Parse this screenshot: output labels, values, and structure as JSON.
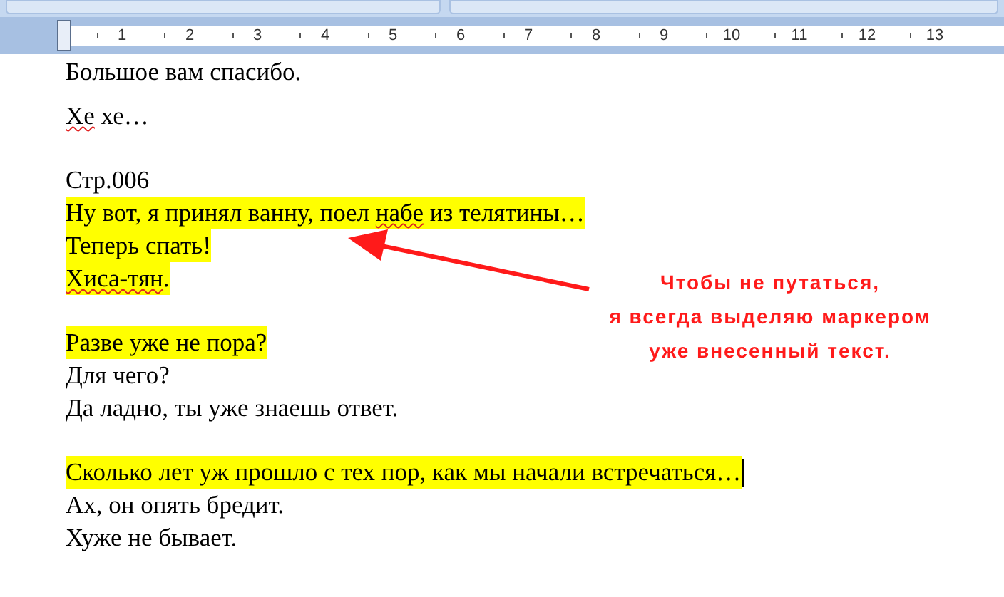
{
  "ruler": {
    "numbers": [
      "1",
      "2",
      "3",
      "4",
      "5",
      "6",
      "7",
      "8",
      "9",
      "10",
      "11",
      "12",
      "13"
    ]
  },
  "paragraphs": [
    {
      "lines": [
        {
          "highlighted": false,
          "cursor": false,
          "segments": [
            {
              "text": "Большое вам спасибо.",
              "misspelled": false
            }
          ]
        }
      ]
    },
    {
      "lines": [
        {
          "highlighted": false,
          "cursor": false,
          "segments": [
            {
              "text": "Хе",
              "misspelled": true
            },
            {
              "text": " хе…",
              "misspelled": false
            }
          ]
        }
      ]
    },
    {
      "lines": [
        {
          "highlighted": false,
          "cursor": false,
          "segments": [
            {
              "text": "Стр.006",
              "misspelled": false
            }
          ]
        },
        {
          "highlighted": true,
          "cursor": false,
          "segments": [
            {
              "text": "Ну вот, я принял ванну, поел ",
              "misspelled": false
            },
            {
              "text": "набе",
              "misspelled": true
            },
            {
              "text": " из телятины…",
              "misspelled": false
            }
          ]
        },
        {
          "highlighted": true,
          "cursor": false,
          "segments": [
            {
              "text": "Теперь спать!",
              "misspelled": false
            }
          ]
        },
        {
          "highlighted": true,
          "cursor": false,
          "segments": [
            {
              "text": "Хиса-тян",
              "misspelled": true
            },
            {
              "text": ".",
              "misspelled": false
            }
          ]
        }
      ]
    },
    {
      "lines": [
        {
          "highlighted": true,
          "cursor": false,
          "segments": [
            {
              "text": "Разве уже не пора?",
              "misspelled": false
            }
          ]
        },
        {
          "highlighted": false,
          "cursor": false,
          "segments": [
            {
              "text": "Для чего?",
              "misspelled": false
            }
          ]
        },
        {
          "highlighted": false,
          "cursor": false,
          "segments": [
            {
              "text": "Да ладно, ты уже знаешь ответ.",
              "misspelled": false
            }
          ]
        }
      ]
    },
    {
      "lines": [
        {
          "highlighted": true,
          "cursor": true,
          "segments": [
            {
              "text": "Сколько лет уж прошло с тех пор, как мы начали встречаться…",
              "misspelled": false
            }
          ]
        },
        {
          "highlighted": false,
          "cursor": false,
          "segments": [
            {
              "text": "Ах, он опять бредит.",
              "misspelled": false
            }
          ]
        },
        {
          "highlighted": false,
          "cursor": false,
          "segments": [
            {
              "text": "Хуже не бывает.",
              "misspelled": false
            }
          ]
        }
      ]
    }
  ],
  "annotation": {
    "lines": [
      "Чтобы не путаться,",
      "я всегда выделяю маркером",
      "уже внесенный текст."
    ]
  }
}
